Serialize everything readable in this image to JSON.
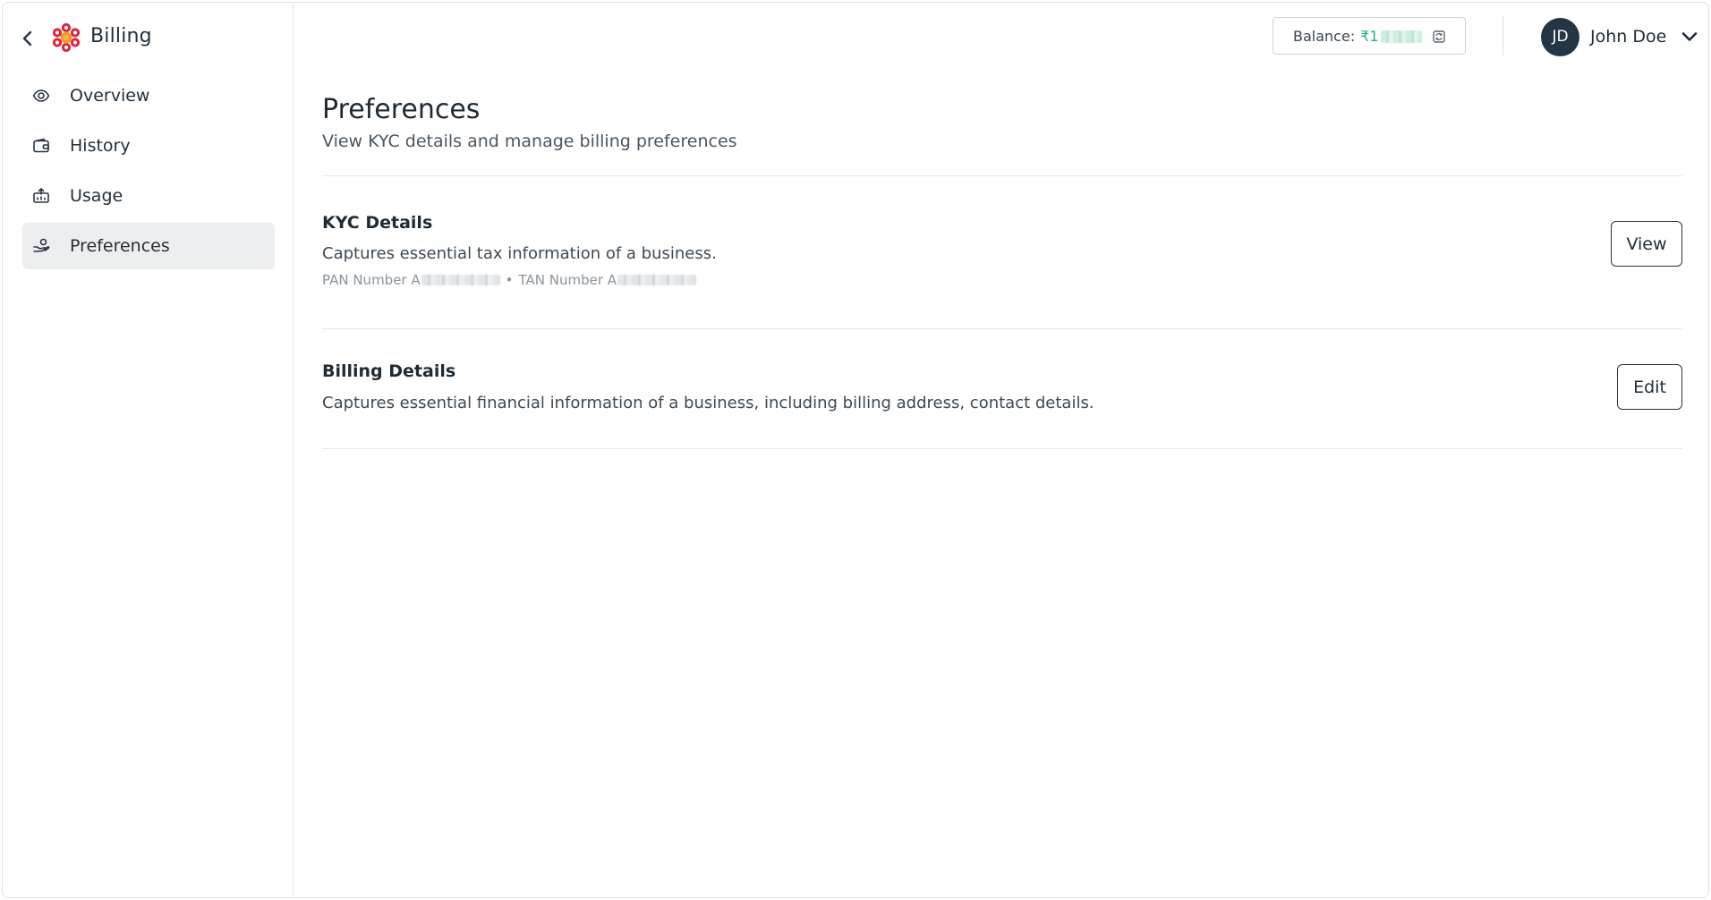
{
  "app": {
    "title": "Billing"
  },
  "sidebar": {
    "items": [
      {
        "label": "Overview",
        "icon": "eye-icon"
      },
      {
        "label": "History",
        "icon": "wallet-icon"
      },
      {
        "label": "Usage",
        "icon": "usage-icon"
      },
      {
        "label": "Preferences",
        "icon": "hand-coins-icon",
        "active": true
      }
    ]
  },
  "header": {
    "balance_label": "Balance:",
    "balance_value": "₹1",
    "user_initials": "JD",
    "user_name": "John Doe"
  },
  "page": {
    "title": "Preferences",
    "subtitle": "View KYC details and manage billing preferences"
  },
  "kyc": {
    "title": "KYC Details",
    "description": "Captures essential tax information of a business.",
    "pan_label": "PAN Number A",
    "separator": "•",
    "tan_label": "TAN Number A",
    "button": "View"
  },
  "billing": {
    "title": "Billing Details",
    "description": "Captures essential financial information of a business, including billing address, contact details.",
    "button": "Edit"
  },
  "colors": {
    "accent_red": "#e0243f",
    "accent_orange": "#f39a2b",
    "balance_green": "#1fb37f",
    "avatar_bg": "#243544",
    "active_nav_bg": "#eceef0"
  }
}
